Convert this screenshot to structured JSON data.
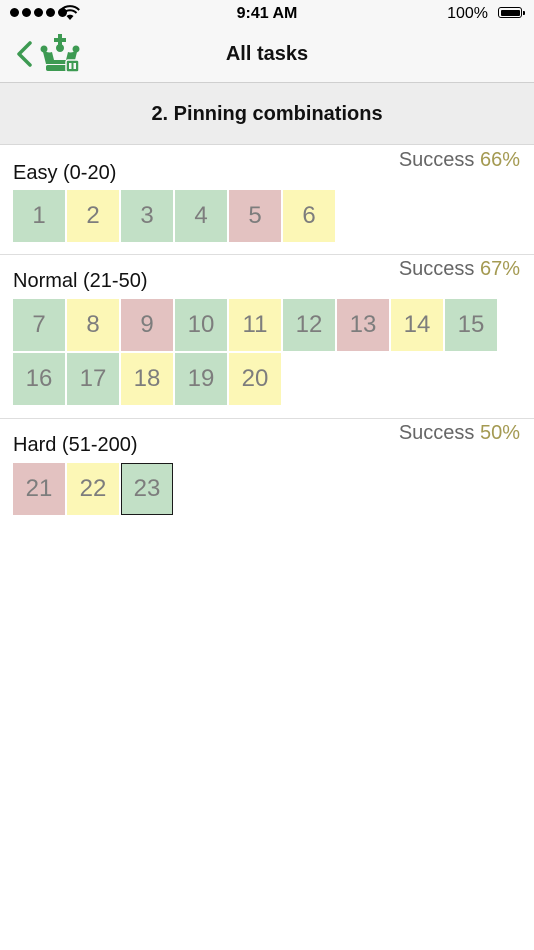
{
  "status_bar": {
    "time": "9:41 AM",
    "battery": "100%"
  },
  "nav": {
    "title": "All tasks"
  },
  "section": {
    "title": "2. Pinning combinations"
  },
  "success_label": "Success",
  "groups": [
    {
      "title": "Easy (0-20)",
      "success_pct": "66%",
      "tasks": [
        {
          "label": "1",
          "state": "green"
        },
        {
          "label": "2",
          "state": "yellow"
        },
        {
          "label": "3",
          "state": "green"
        },
        {
          "label": "4",
          "state": "green"
        },
        {
          "label": "5",
          "state": "red"
        },
        {
          "label": "6",
          "state": "yellow"
        }
      ]
    },
    {
      "title": "Normal (21-50)",
      "success_pct": "67%",
      "tasks": [
        {
          "label": "7",
          "state": "green"
        },
        {
          "label": "8",
          "state": "yellow"
        },
        {
          "label": "9",
          "state": "red"
        },
        {
          "label": "10",
          "state": "green"
        },
        {
          "label": "11",
          "state": "yellow"
        },
        {
          "label": "12",
          "state": "green"
        },
        {
          "label": "13",
          "state": "red"
        },
        {
          "label": "14",
          "state": "yellow"
        },
        {
          "label": "15",
          "state": "green"
        },
        {
          "label": "16",
          "state": "green"
        },
        {
          "label": "17",
          "state": "green"
        },
        {
          "label": "18",
          "state": "yellow"
        },
        {
          "label": "19",
          "state": "green"
        },
        {
          "label": "20",
          "state": "yellow"
        }
      ]
    },
    {
      "title": "Hard (51-200)",
      "success_pct": "50%",
      "tasks": [
        {
          "label": "21",
          "state": "red"
        },
        {
          "label": "22",
          "state": "yellow"
        },
        {
          "label": "23",
          "state": "green",
          "current": true
        }
      ]
    }
  ],
  "colors": {
    "accent": "#3d9a52",
    "success_pct": "#a49a52",
    "tile_green": "#c2e0c6",
    "tile_yellow": "#fcf7b6",
    "tile_red": "#e3c2c1"
  },
  "icons": {
    "back": "chevron-left-icon",
    "logo": "chess-king-logo-icon"
  }
}
